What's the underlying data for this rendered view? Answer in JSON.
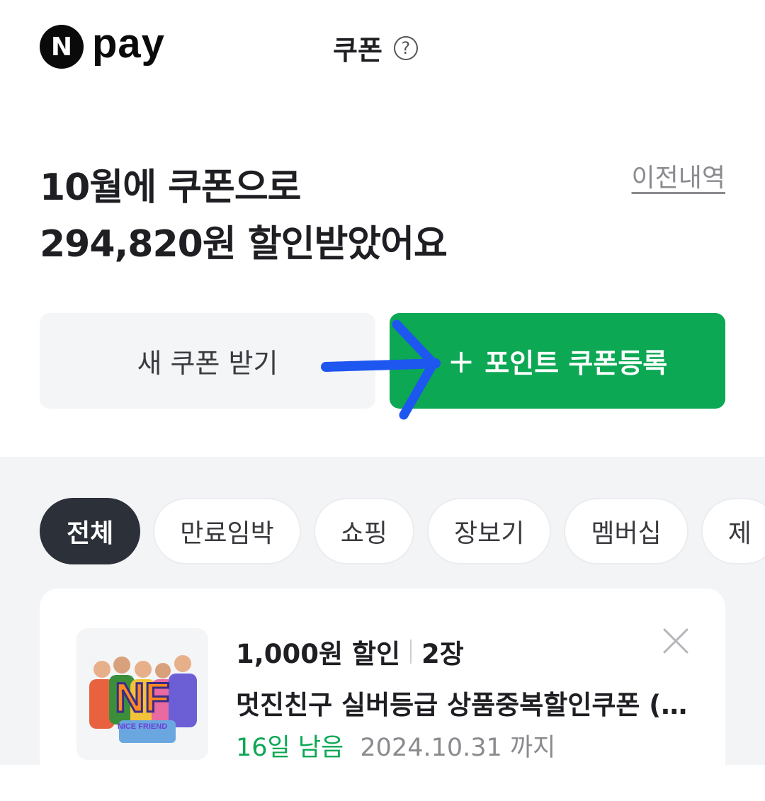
{
  "header": {
    "logo_letter": "N",
    "logo_text": "pay",
    "title": "쿠폰",
    "help_symbol": "?"
  },
  "summary": {
    "line1": "10월에 쿠폰으로",
    "line2": "294,820원 할인받았어요",
    "history_link": "이전내역"
  },
  "actions": {
    "get_coupon": "새 쿠폰 받기",
    "register_symbol": "+",
    "register_coupon": "포인트 쿠폰등록"
  },
  "filters": [
    {
      "label": "전체",
      "active": true
    },
    {
      "label": "만료임박",
      "active": false
    },
    {
      "label": "쇼핑",
      "active": false
    },
    {
      "label": "장보기",
      "active": false
    },
    {
      "label": "멤버십",
      "active": false
    },
    {
      "label": "제",
      "active": false
    }
  ],
  "coupon": {
    "discount": "1,000원 할인",
    "count": "2장",
    "name": "멋진친구 실버등급 상품중복할인쿠폰 (…",
    "remaining": "16일 남음",
    "expiry": "2024.10.31 까지",
    "thumbnail_text": "NICE FRIEND"
  },
  "colors": {
    "brand_green": "#0ca854",
    "annotation_blue": "#1e56f0",
    "chip_active": "#2c3038"
  }
}
